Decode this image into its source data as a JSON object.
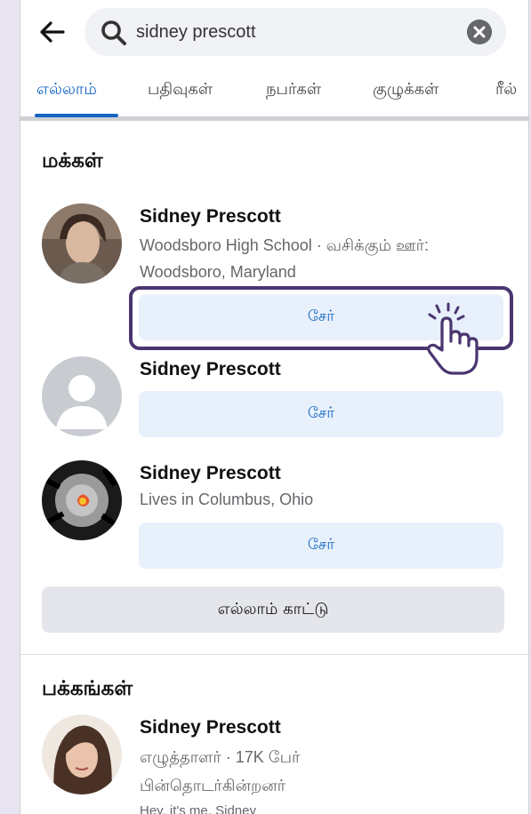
{
  "search": {
    "value": "sidney prescott"
  },
  "tabs": [
    {
      "label": "எல்லாம்",
      "active": true
    },
    {
      "label": "பதிவுகள்"
    },
    {
      "label": "நபர்கள்"
    },
    {
      "label": "குழுக்கள்"
    },
    {
      "label": "ரீல்"
    }
  ],
  "people_section": {
    "title": "மக்கள்",
    "results": [
      {
        "name": "Sidney Prescott",
        "line1": "Woodsboro High School · வசிக்கும் ஊர்:",
        "line2": "Woodsboro, Maryland",
        "button": "சேர்"
      },
      {
        "name": "Sidney Prescott",
        "button": "சேர்"
      },
      {
        "name": "Sidney Prescott",
        "line1": "Lives in Columbus, Ohio",
        "button": "சேர்"
      }
    ],
    "see_all": "எல்லாம் காட்டு"
  },
  "pages_section": {
    "title": "பக்கங்கள்",
    "results": [
      {
        "name": "Sidney Prescott",
        "line1": "எழுத்தாளர் · 17K பேர்",
        "line2": "பின்தொடர்கின்றனர்",
        "line3": "Hey, it's me, Sidney"
      }
    ]
  },
  "colors": {
    "accent": "#1565c0",
    "highlight": "#4a3670",
    "join_bg": "#e7f0fb"
  }
}
